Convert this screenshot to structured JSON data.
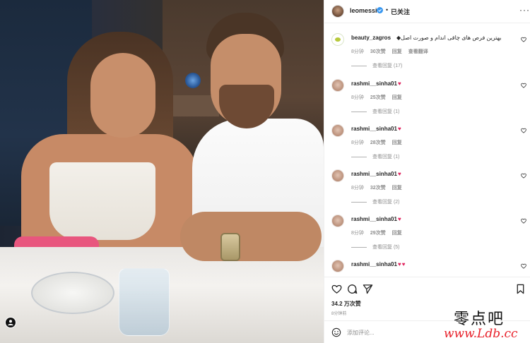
{
  "post": {
    "author": "leomessi",
    "follow_state": "已关注",
    "separator": "•",
    "more": "···"
  },
  "comments": [
    {
      "user": "beauty_zagros",
      "text": "◆بهترین فرص های چاقی اندام و صورت اصل",
      "hearts": "",
      "time": "8分钟",
      "likes": "30次赞",
      "reply": "回复",
      "translate": "查看翻译",
      "view_replies": "查看回复 (17)"
    },
    {
      "user": "rashmi__sinha01",
      "text": "",
      "hearts": "♥",
      "time": "8分钟",
      "likes": "25次赞",
      "reply": "回复",
      "translate": "",
      "view_replies": "查看回复 (1)"
    },
    {
      "user": "rashmi__sinha01",
      "text": "",
      "hearts": "♥",
      "time": "8分钟",
      "likes": "28次赞",
      "reply": "回复",
      "translate": "",
      "view_replies": "查看回复 (1)"
    },
    {
      "user": "rashmi__sinha01",
      "text": "",
      "hearts": "♥",
      "time": "8分钟",
      "likes": "32次赞",
      "reply": "回复",
      "translate": "",
      "view_replies": "查看回复 (2)"
    },
    {
      "user": "rashmi__sinha01",
      "text": "",
      "hearts": "♥",
      "time": "8分钟",
      "likes": "29次赞",
      "reply": "回复",
      "translate": "",
      "view_replies": "查看回复 (5)"
    },
    {
      "user": "rashmi__sinha01",
      "text": "",
      "hearts": "♥♥",
      "time": "8分钟",
      "likes": "",
      "reply": "",
      "translate": "",
      "view_replies": ""
    }
  ],
  "actions": {
    "likes_count": "34.2 万次赞",
    "posted_time": "8分钟前",
    "comment_placeholder": "添加评论..."
  },
  "watermark": {
    "site_name": "零点吧",
    "site_url": "www.Ldb.cc"
  },
  "colors": {
    "heart": "#e0245e",
    "verified": "#3897f0",
    "text_primary": "#262626",
    "text_secondary": "#8e8e8e"
  }
}
